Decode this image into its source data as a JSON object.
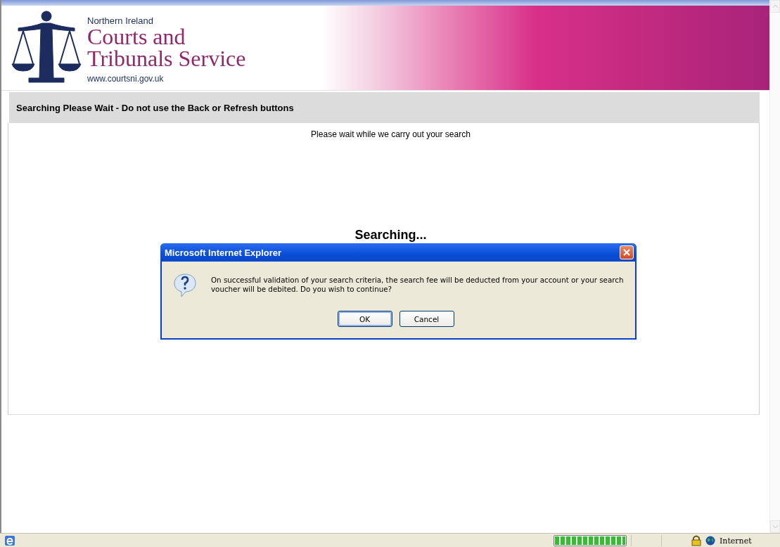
{
  "header": {
    "region": "Northern Ireland",
    "title_line_1": "Courts and",
    "title_line_2": "Tribunals Service",
    "url": "www.courtsni.gov.uk"
  },
  "notice_bar": {
    "text": "Searching Please Wait - Do not use the Back or Refresh buttons"
  },
  "wait_message": "Please wait while we carry out your search",
  "searching_text": "Searching...",
  "dialog": {
    "title": "Microsoft Internet Explorer",
    "message": "On successful validation of your search criteria, the search fee will be deducted from your account or your search voucher will be debited. Do you wish to continue?",
    "buttons": [
      {
        "label": "OK",
        "selected": true
      },
      {
        "label": "Cancel",
        "selected": false
      }
    ]
  },
  "status_bar": {
    "progress": {
      "level": 1
    },
    "zone": "Internet"
  }
}
